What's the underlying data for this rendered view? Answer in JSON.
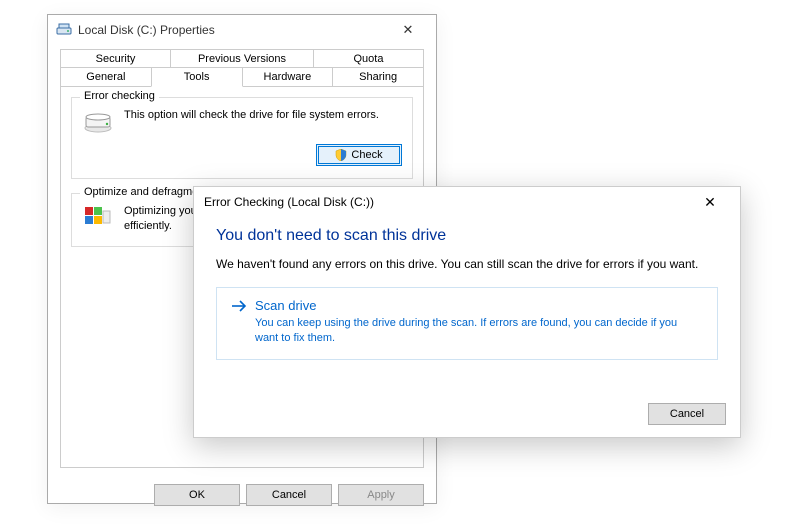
{
  "properties": {
    "title": "Local Disk (C:) Properties",
    "tabs_row1": [
      "Security",
      "Previous Versions",
      "Quota"
    ],
    "tabs_row2": [
      "General",
      "Tools",
      "Hardware",
      "Sharing"
    ],
    "active_tab": "Tools",
    "error_checking": {
      "legend": "Error checking",
      "desc": "This option will check the drive for file system errors.",
      "button": "Check"
    },
    "optimize": {
      "legend": "Optimize and defragment drive",
      "desc": "Optimizing your computer's drives can help it run more efficiently."
    },
    "buttons": {
      "ok": "OK",
      "cancel": "Cancel",
      "apply": "Apply"
    }
  },
  "error_dialog": {
    "title": "Error Checking (Local Disk (C:))",
    "heading": "You don't need to scan this drive",
    "message": "We haven't found any errors on this drive. You can still scan the drive for errors if you want.",
    "scan_label": "Scan drive",
    "scan_sub": "You can keep using the drive during the scan. If errors are found, you can decide if you want to fix them.",
    "cancel": "Cancel"
  }
}
